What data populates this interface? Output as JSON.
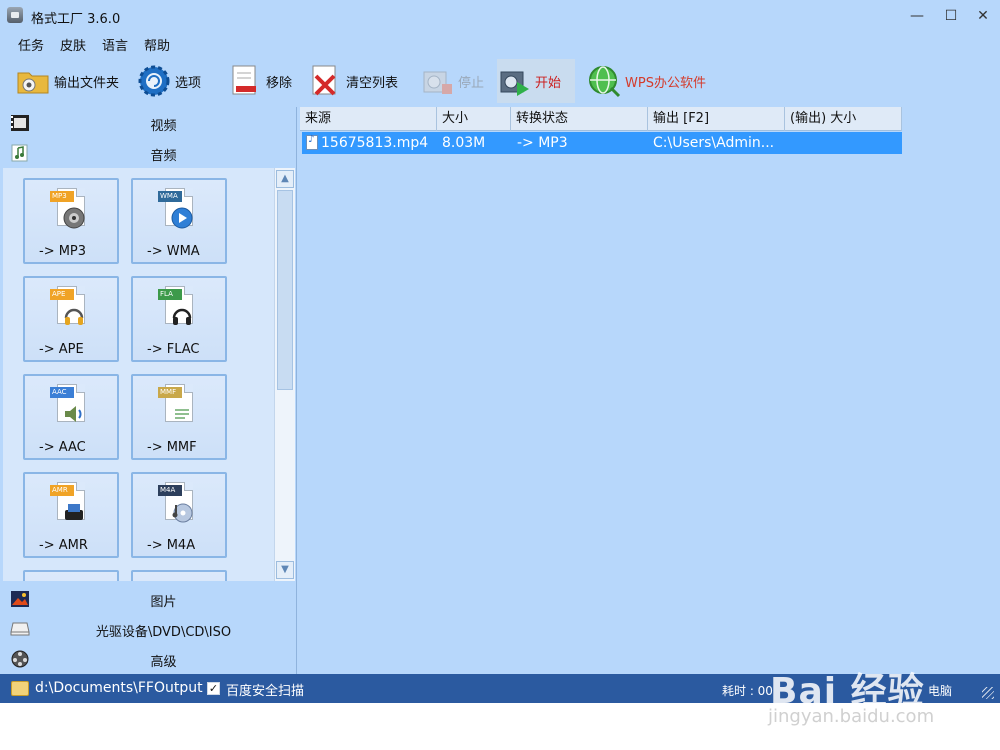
{
  "window": {
    "title": "格式工厂 3.6.0",
    "min_glyph": "—",
    "max_glyph": "☐",
    "close_glyph": "✕"
  },
  "menu": [
    "任务",
    "皮肤",
    "语言",
    "帮助"
  ],
  "toolbar": {
    "output_folder": "输出文件夹",
    "options": "选项",
    "remove": "移除",
    "clear_list": "清空列表",
    "stop": "停止",
    "start": "开始",
    "wps": "WPS办公软件"
  },
  "categories": {
    "video": "视频",
    "audio": "音频",
    "picture": "图片",
    "optical": "光驱设备\\DVD\\CD\\ISO",
    "advanced": "高级"
  },
  "formats": [
    {
      "tag": "MP3",
      "label": "-> MP3",
      "color": "#f0a326"
    },
    {
      "tag": "WMA",
      "label": "-> WMA",
      "color": "#2f6a9a"
    },
    {
      "tag": "APE",
      "label": "-> APE",
      "color": "#f0a326"
    },
    {
      "tag": "FLA",
      "label": "-> FLAC",
      "color": "#3d9a4a"
    },
    {
      "tag": "AAC",
      "label": "-> AAC",
      "color": "#3b7fd6"
    },
    {
      "tag": "MMF",
      "label": "-> MMF",
      "color": "#c9a84a"
    },
    {
      "tag": "AMR",
      "label": "-> AMR",
      "color": "#f0a326"
    },
    {
      "tag": "M4A",
      "label": "-> M4A",
      "color": "#2d3f5c"
    }
  ],
  "list": {
    "columns": [
      "来源",
      "大小",
      "转换状态",
      "输出 [F2]",
      "(输出) 大小"
    ],
    "rows": [
      {
        "source": "15675813.mp4",
        "size": "8.03M",
        "status": "-> MP3",
        "output": "C:\\Users\\Admin...",
        "output_size": ""
      }
    ]
  },
  "statusbar": {
    "output_path": "d:\\Documents\\FFOutput",
    "scan_checked": "✓",
    "scan_label": "百度安全扫描",
    "elapsed": "耗时 : 00",
    "shutdown": "电脑"
  },
  "watermark": {
    "logo": "Bai 经验",
    "url": "jingyan.baidu.com"
  },
  "colors": {
    "window_bg": "#b7d7fb",
    "selection": "#3399ff",
    "statusbar": "#2b5aa0",
    "start_text": "#cc1f1f"
  }
}
